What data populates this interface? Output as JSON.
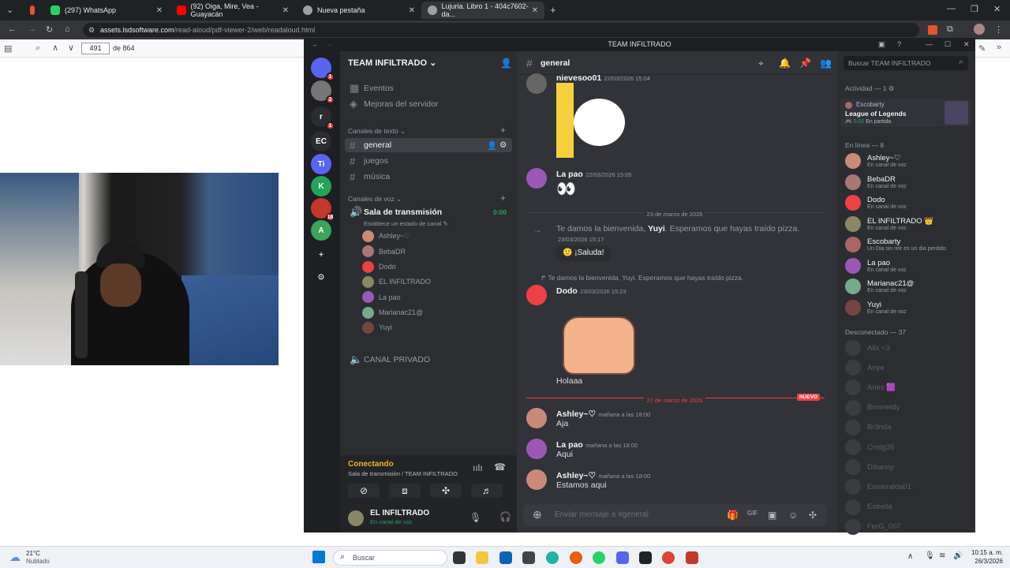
{
  "browser": {
    "tabs": [
      {
        "label": "(297) WhatsApp",
        "color": "#25d366"
      },
      {
        "label": "(92) Oiga, Mire, Vea - Guayacán",
        "color": "#ff0000"
      },
      {
        "label": "Nueva pestaña",
        "color": "#9aa0a6"
      },
      {
        "label": "Lujuria. Libro 1 - 404c7602-da...",
        "color": "#9aa0a6"
      }
    ],
    "url_host": "assets.lsdsoftware.com",
    "url_path": "/read-aloud/pdf-viewer-2/web/readaloud.html"
  },
  "pdf": {
    "page": "491",
    "total": "de 864"
  },
  "discord": {
    "window_title": "TEAM INFILTRADO",
    "server_name": "TEAM INFILTRADO",
    "servers": [
      {
        "label": "",
        "badge": "1",
        "color": "#5865f2"
      },
      {
        "label": "",
        "badge": "2",
        "color": "#777"
      },
      {
        "label": "r",
        "badge": "1",
        "color": "#2b2d31"
      },
      {
        "label": "EC",
        "badge": "",
        "color": "#2b2d31"
      },
      {
        "label": "Ti",
        "badge": "",
        "color": "#5865f2"
      },
      {
        "label": "K",
        "badge": "",
        "color": "#23a559"
      },
      {
        "label": "",
        "badge": "18",
        "color": "#c0392b"
      },
      {
        "label": "A",
        "badge": "",
        "color": "#3ba55c"
      }
    ],
    "top_items": [
      "Eventos",
      "Mejoras del servidor"
    ],
    "text_category": "Canales de texto",
    "text_channels": [
      "general",
      "juegos",
      "música"
    ],
    "voice_category": "Canales de voz",
    "voice_channel": {
      "name": "Sala de transmisión",
      "timer": "0:00",
      "status": "Establece un estado de canal"
    },
    "voice_users": [
      {
        "name": "Ashley~♡",
        "color": "#c98a7a"
      },
      {
        "name": "BebaDR",
        "color": "#a77"
      },
      {
        "name": "Dodo",
        "color": "#ed4245"
      },
      {
        "name": "EL INFILTRADO",
        "color": "#886"
      },
      {
        "name": "La pao",
        "color": "#9b59b6"
      },
      {
        "name": "Marianac21@",
        "color": "#7a8"
      },
      {
        "name": "Yuyi",
        "color": "#744"
      }
    ],
    "private_channel": "CANAL PRIVADO",
    "connecting": {
      "title": "Conectando",
      "sub": "Sala de transmisión / TEAM INFILTRADO"
    },
    "user_panel": {
      "name": "EL INFILTRADO",
      "status": "En canal de voz"
    },
    "chat": {
      "channel": "general",
      "top_author": "nievesoo01",
      "top_time": "22/03/2026 15:04",
      "messages": [
        {
          "author": "La pao",
          "time": "22/03/2026 15:05",
          "text": "👀"
        },
        {
          "divider": "23 de marzo de 2026"
        },
        {
          "welcome_pre": "Te damos la bienvenida,",
          "welcome_name": "Yuyi",
          "welcome_post": ". Esperamos que hayas traído pizza.",
          "time": "23/03/2026 15:17",
          "button": "¡Saluda!"
        },
        {
          "reply": "Te damos la bienvenida, Yuyi. Esperamos que hayas traído pizza.",
          "author": "Dodo",
          "time": "23/03/2026 15:23",
          "text": "Holaaa"
        },
        {
          "divider": "27 de marzo de 2026",
          "badge": "NUEVO"
        },
        {
          "author": "Ashley~♡",
          "time": "mañana a las 18:00",
          "text": "Aja"
        },
        {
          "author": "La pao",
          "time": "mañana a las 18:00",
          "text": "Aqui"
        },
        {
          "author": "Ashley~♡",
          "time": "mañana a las 18:00",
          "text": "Estamos aqui"
        }
      ],
      "input_placeholder": "Enviar mensaje a #general"
    },
    "members": {
      "search_placeholder": "Buscar TEAM INFILTRADO",
      "activity_header": "Actividad — 1",
      "activity": {
        "name": "Escobarty",
        "game": "League of Legends",
        "time": "0:00",
        "state": "En partida"
      },
      "online_header": "En línea — 8",
      "online": [
        {
          "name": "Ashley~♡",
          "status": "En canal de voz",
          "color": "#c98a7a"
        },
        {
          "name": "BebaDR",
          "status": "En canal de voz",
          "color": "#a77"
        },
        {
          "name": "Dodo",
          "status": "En canal de voz",
          "color": "#ed4245"
        },
        {
          "name": "EL INFILTRADO 👑",
          "status": "En canal de voz",
          "color": "#886"
        },
        {
          "name": "Escobarty",
          "status": "Un Dia sin reir es un dia perdido",
          "color": "#a66"
        },
        {
          "name": "La pao",
          "status": "En canal de voz",
          "color": "#9b59b6"
        },
        {
          "name": "Marianac21@",
          "status": "En canal de voz",
          "color": "#7a8"
        },
        {
          "name": "Yuyi",
          "status": "En canal de voz",
          "color": "#744"
        }
      ],
      "offline_header": "Desconectado — 37",
      "offline": [
        "Alix <3",
        "Anye",
        "Aries 🟪",
        "Biosneidy",
        "Br3nda",
        "Crislg35",
        "Dilianny",
        "Esmeralda01",
        "Estrella",
        "FerG_007"
      ]
    }
  },
  "taskbar": {
    "weather_temp": "21°C",
    "weather_desc": "Nublado",
    "search": "Buscar",
    "time": "10:15 a. m.",
    "date": "26/3/2026"
  }
}
